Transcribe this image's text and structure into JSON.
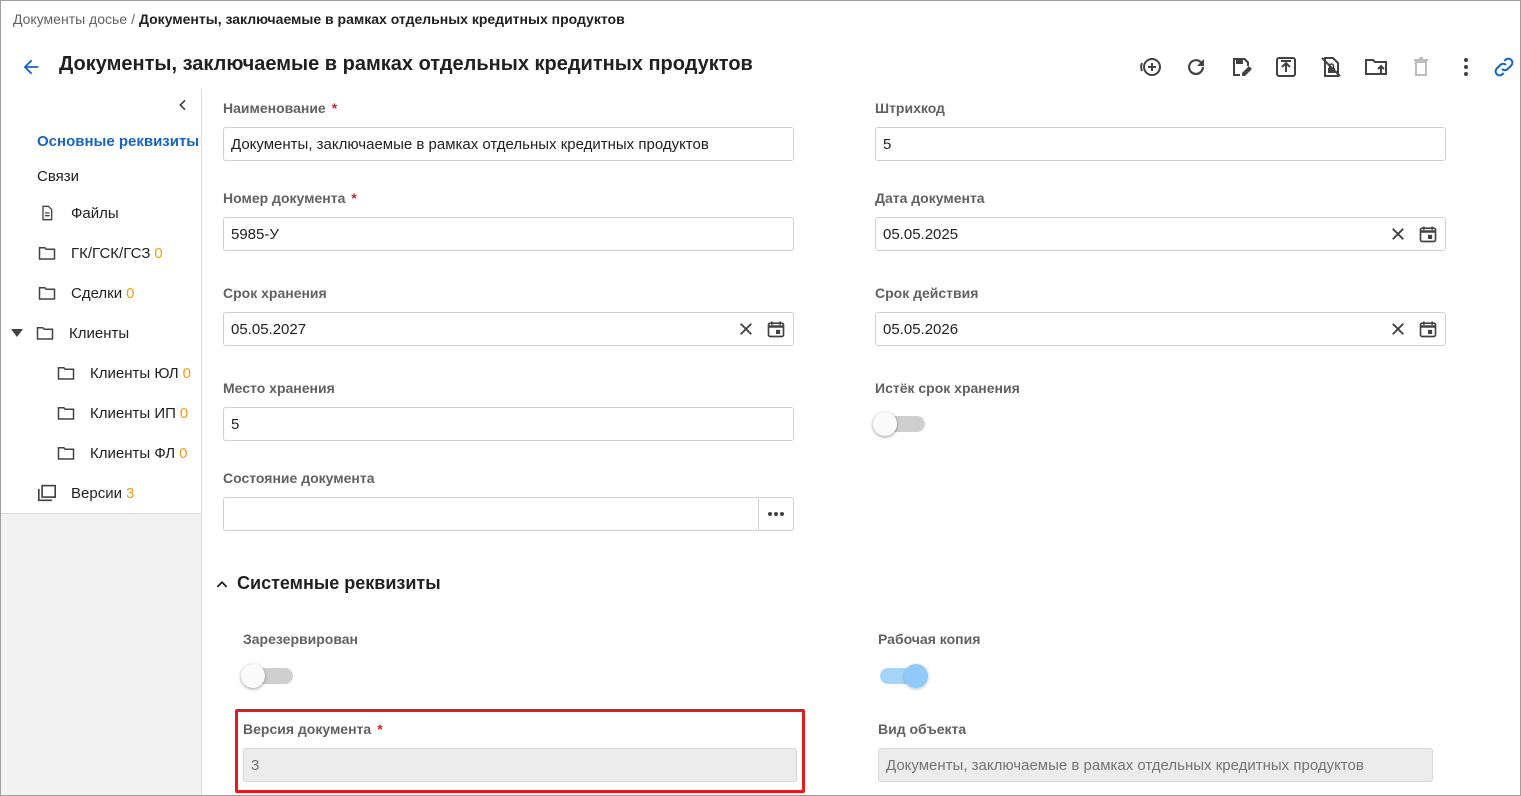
{
  "breadcrumb": {
    "parent": "Документы досье",
    "separator": "/",
    "current": "Документы, заключаемые в рамках отдельных кредитных продуктов"
  },
  "header": {
    "title": "Документы, заключаемые в рамках отдельных кредитных продуктов",
    "back_icon": "arrow-left-icon",
    "toolbar": [
      {
        "name": "add-circle-icon"
      },
      {
        "name": "refresh-icon"
      },
      {
        "name": "save-edit-icon"
      },
      {
        "name": "upload-icon"
      },
      {
        "name": "unlock-file-icon"
      },
      {
        "name": "folder-move-icon"
      },
      {
        "name": "delete-icon"
      },
      {
        "name": "more-vertical-icon"
      },
      {
        "name": "link-icon"
      }
    ]
  },
  "sidebar": {
    "items": [
      {
        "label": "Основные реквизиты",
        "active": true
      },
      {
        "label": "Связи"
      },
      {
        "label": "Файлы",
        "icon": "file-icon"
      },
      {
        "label": "ГК/ГСК/ГСЗ",
        "count": "0",
        "icon": "folder-icon"
      },
      {
        "label": "Сделки",
        "count": "0",
        "icon": "folder-icon"
      },
      {
        "label": "Клиенты",
        "icon": "folder-icon",
        "expanded": true
      },
      {
        "label": "Клиенты ЮЛ",
        "count": "0",
        "icon": "folder-icon"
      },
      {
        "label": "Клиенты ИП",
        "count": "0",
        "icon": "folder-icon"
      },
      {
        "label": "Клиенты ФЛ",
        "count": "0",
        "icon": "folder-icon"
      },
      {
        "label": "Версии",
        "count": "3",
        "icon": "versions-icon"
      }
    ]
  },
  "form": {
    "name": {
      "label": "Наименование",
      "required": "*",
      "value": "Документы, заключаемые в рамках отдельных кредитных продуктов"
    },
    "barcode": {
      "label": "Штрихкод",
      "value": "5"
    },
    "doc_number": {
      "label": "Номер документа",
      "required": "*",
      "value": "5985-У"
    },
    "doc_date": {
      "label": "Дата документа",
      "value": "05.05.2025"
    },
    "storage_term": {
      "label": "Срок хранения",
      "value": "05.05.2027"
    },
    "validity_term": {
      "label": "Срок действия",
      "value": "05.05.2026"
    },
    "storage_place": {
      "label": "Место хранения",
      "value": "5"
    },
    "storage_expired": {
      "label": "Истёк срок хранения",
      "on": false
    },
    "doc_state": {
      "label": "Состояние документа",
      "value": ""
    }
  },
  "system_section": {
    "title": "Системные реквизиты",
    "reserved": {
      "label": "Зарезервирован",
      "on": false
    },
    "working_copy": {
      "label": "Рабочая копия",
      "on": true
    },
    "doc_version": {
      "label": "Версия документа",
      "required": "*",
      "value": "3"
    },
    "object_type": {
      "label": "Вид объекта",
      "value": "Документы, заключаемые в рамках отдельных кредитных продуктов"
    }
  },
  "colors": {
    "accent": "#1565c0",
    "count": "#f39c12",
    "required": "#c62828",
    "highlight": "#e31b1b"
  }
}
